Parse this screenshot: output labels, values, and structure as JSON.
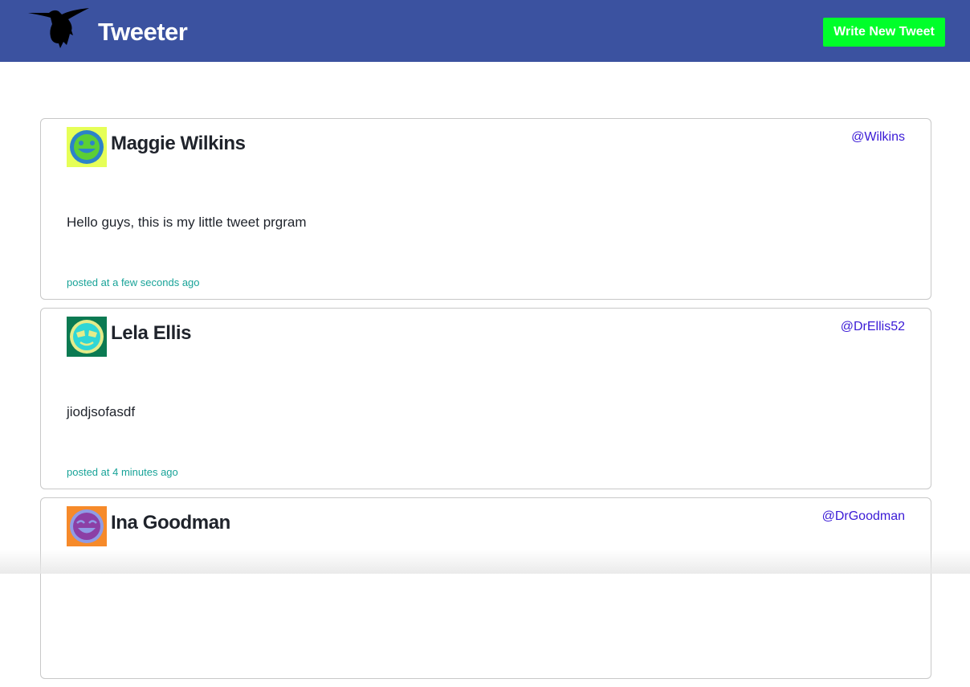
{
  "header": {
    "brand": "Tweeter",
    "logo_icon": "hummingbird-icon",
    "write_button_label": "Write New Tweet",
    "colors": {
      "navbar": "#3b52a0",
      "button": "#00ff2a"
    }
  },
  "tweets": [
    {
      "name": "Maggie Wilkins",
      "handle": "@Wilkins",
      "content": "Hello guys, this is my little tweet prgram",
      "timestamp": "posted at a few seconds ago",
      "avatar_icon": "smiley-avatar-icon"
    },
    {
      "name": "Lela Ellis",
      "handle": "@DrEllis52",
      "content": "jiodjsofasdf",
      "timestamp": "posted at 4 minutes ago",
      "avatar_icon": "sleepy-face-avatar-icon"
    },
    {
      "name": "Ina Goodman",
      "handle": "@DrGoodman",
      "content": "",
      "timestamp": "",
      "avatar_icon": "laughing-face-avatar-icon"
    }
  ]
}
